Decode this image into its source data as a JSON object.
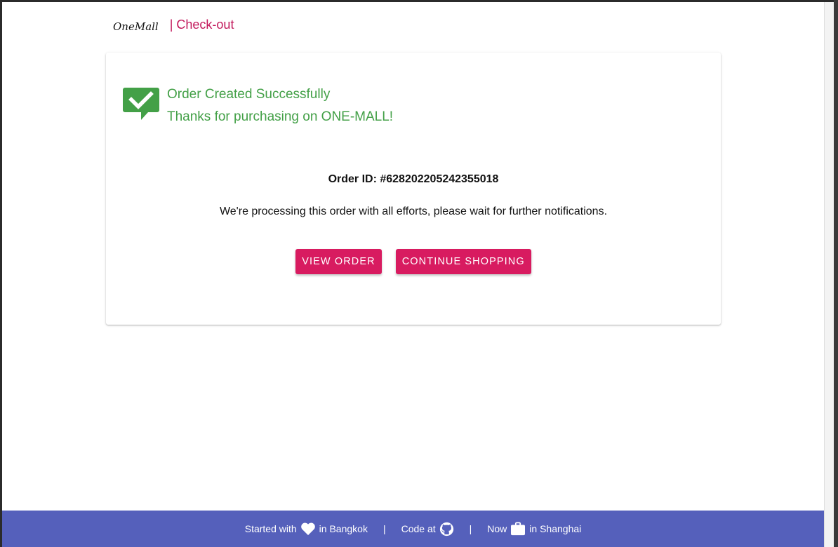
{
  "header": {
    "logo": "OneMall",
    "section": "| Check-out"
  },
  "card": {
    "success_title": "Order Created Successfully",
    "success_subtitle": "Thanks for purchasing on ONE-MALL!",
    "order_id": "Order ID: #628202205242355018",
    "message": "We're processing this order with all efforts, please wait for further notifications.",
    "view_order_label": "VIEW ORDER",
    "continue_label": "CONTINUE SHOPPING"
  },
  "footer": {
    "started_prefix": "Started with",
    "started_suffix": "in Bangkok",
    "code_prefix": "Code at",
    "now_prefix": "Now",
    "now_suffix": "in Shanghai",
    "separator": "|"
  },
  "icons": {
    "success": "comment-check-icon",
    "heart": "heart-icon",
    "github": "github-icon",
    "briefcase": "briefcase-icon"
  },
  "colors": {
    "accent": "#d81b60",
    "success": "#43a047",
    "footer_bg": "#5560bb"
  }
}
